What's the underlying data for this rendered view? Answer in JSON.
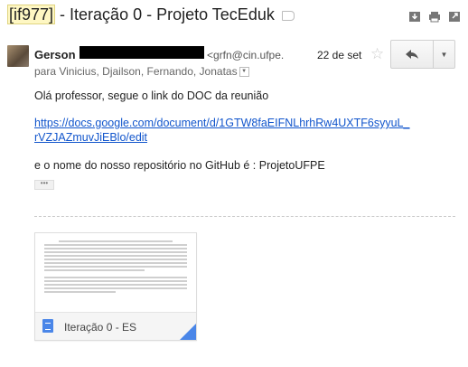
{
  "header": {
    "tag": "[if977]",
    "subject": " - Iteração 0 - Projeto TecEduk"
  },
  "toolbar": {
    "icons": [
      "download-icon",
      "print-icon",
      "open-in-new-window-icon"
    ]
  },
  "message": {
    "sender_name": "Gerson",
    "sender_email": "<grfn@cin.ufpe.",
    "date": "22 de set",
    "recipients": "para Vinicius, Djailson, Fernando, Jonatas",
    "greeting": "Olá professor, segue o link do DOC da reunião",
    "link_line1": "https://docs.google.com/document/d/1GTW8faEIFNLhrhRw4UXTF6syyuL_",
    "link_line2": "rVZJAZmuvJiEBlo/edit",
    "repo_line": "e o nome do nosso repositório no GitHub é : ProjetoUFPE",
    "ellipsis": "•••"
  },
  "attachment": {
    "name": "Iteração 0 - ES",
    "color": "#4a86e8"
  }
}
